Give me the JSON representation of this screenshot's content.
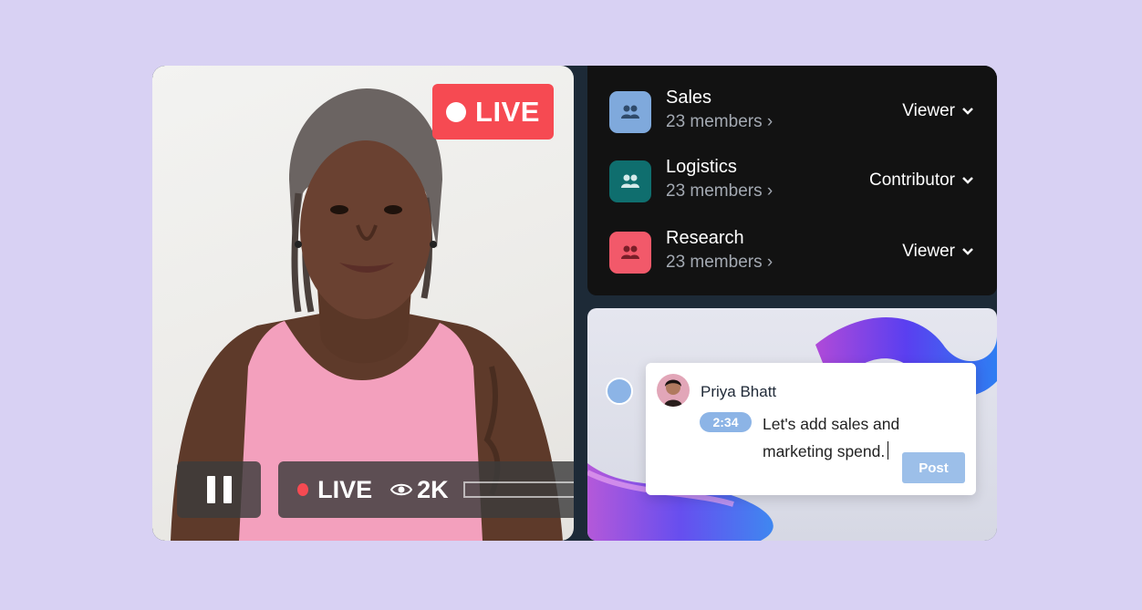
{
  "video": {
    "live_badge": "LIVE",
    "status_live": "LIVE",
    "viewer_count": "2K",
    "icons": [
      "pause-icon",
      "eye-icon",
      "live-dot-icon"
    ]
  },
  "teams": [
    {
      "name": "Sales",
      "members": "23 members",
      "role": "Viewer",
      "color": "#7fa9dc"
    },
    {
      "name": "Logistics",
      "members": "23 members",
      "role": "Contributor",
      "color": "#0f6e6e"
    },
    {
      "name": "Research",
      "members": "23 members",
      "role": "Viewer",
      "color": "#f2596a"
    }
  ],
  "comment": {
    "author": "Priya Bhatt",
    "timestamp": "2:34",
    "text": "Let's add sales and marketing spend.",
    "post_label": "Post"
  },
  "colors": {
    "background": "#d8d1f3",
    "live_red": "#f64a52",
    "accent_blue": "#8cb4e6",
    "teams_panel": "#121212"
  }
}
